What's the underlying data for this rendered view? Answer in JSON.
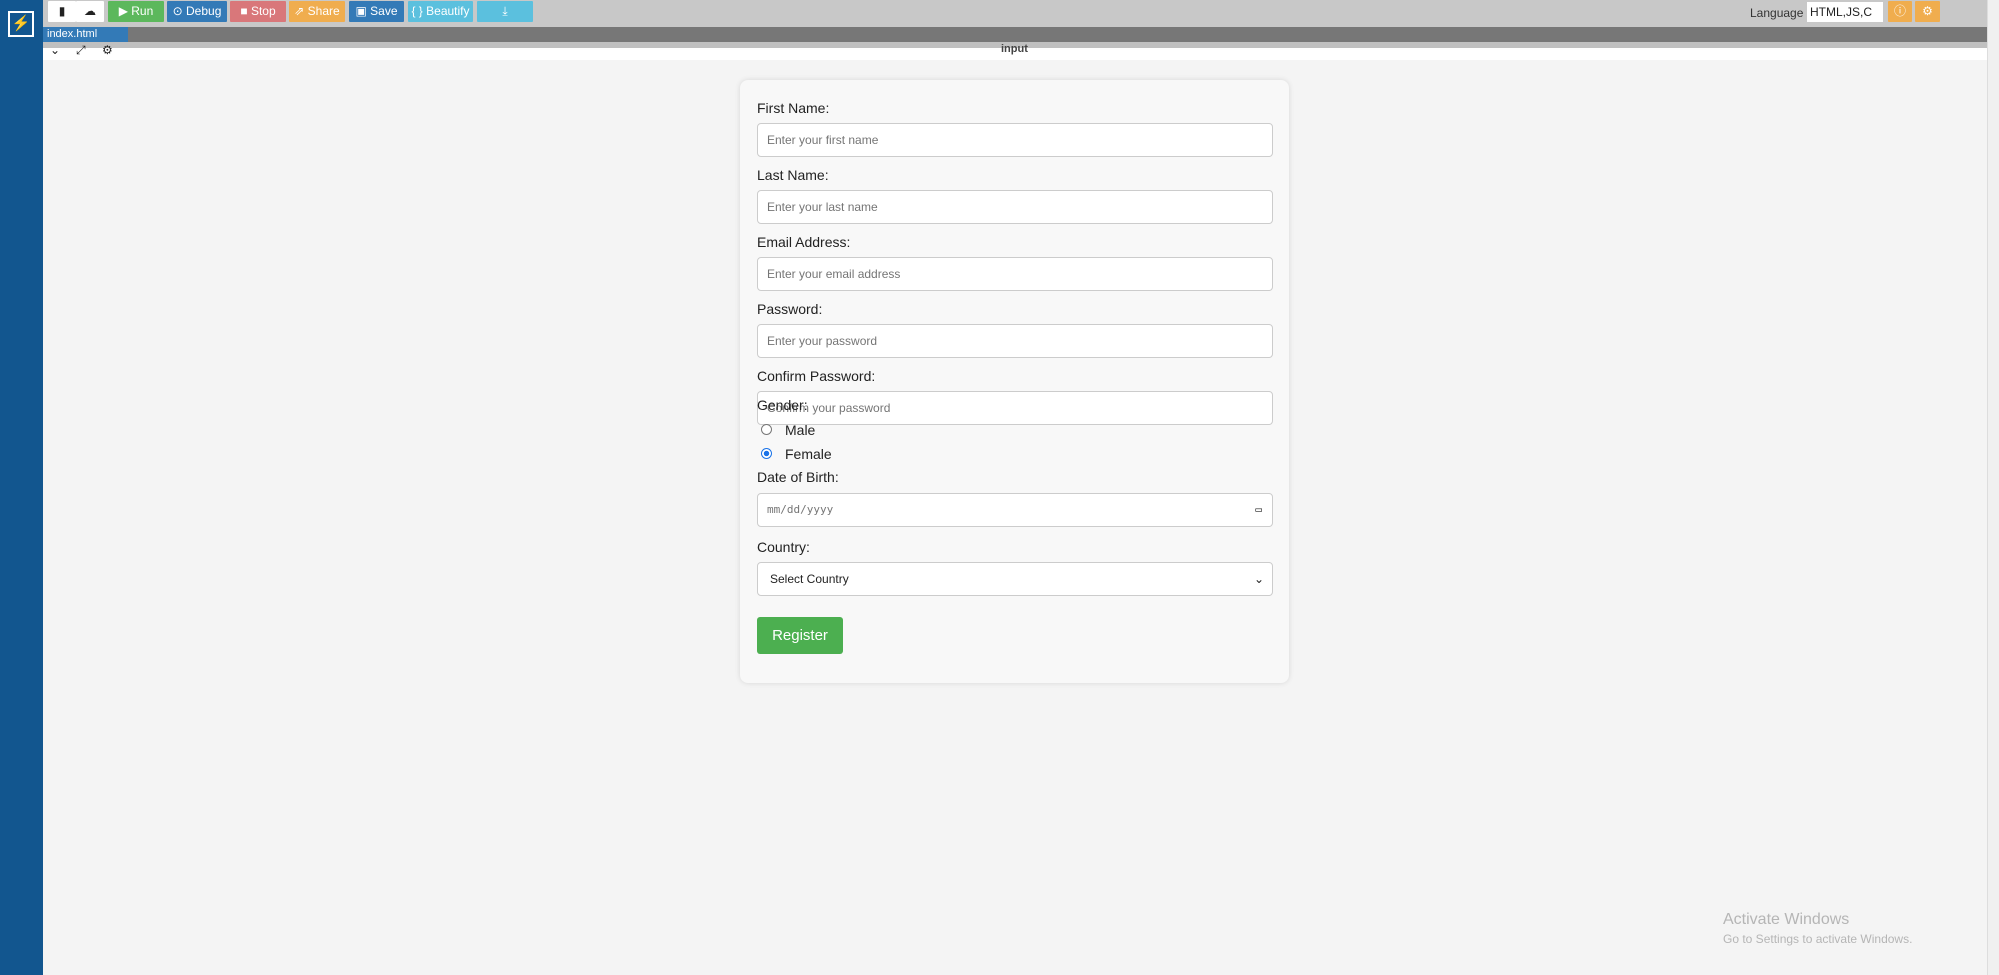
{
  "toolbar": {
    "run": "Run",
    "debug": "Debug",
    "stop": "Stop",
    "share": "Share",
    "save": "Save",
    "beautify": "{ } Beautify",
    "language_label": "Language",
    "language_value": "HTML,JS,C"
  },
  "colors": {
    "run": "#5cb85c",
    "debug": "#337ab7",
    "stop": "#d9777a",
    "share": "#f0ad4e",
    "save": "#337ab7",
    "beautify": "#5bc0de",
    "sidebar": "#12568f",
    "register": "#4caf50"
  },
  "tab": {
    "label": "index.html"
  },
  "panel": {
    "title": "input"
  },
  "form": {
    "first_name": {
      "label": "First Name:",
      "placeholder": "Enter your first name"
    },
    "last_name": {
      "label": "Last Name:",
      "placeholder": "Enter your last name"
    },
    "email": {
      "label": "Email Address:",
      "placeholder": "Enter your email address"
    },
    "password": {
      "label": "Password:",
      "placeholder": "Enter your password"
    },
    "confirm": {
      "label": "Confirm Password:",
      "placeholder": "Confirm your password"
    },
    "gender": {
      "label": "Gender:",
      "options": [
        "Male",
        "Female"
      ],
      "selected": "Female"
    },
    "dob": {
      "label": "Date of Birth:",
      "placeholder": "mm/dd/yyyy"
    },
    "country": {
      "label": "Country:",
      "selected": "Select Country"
    },
    "register": "Register"
  },
  "watermark": {
    "title": "Activate Windows",
    "subtitle": "Go to Settings to activate Windows."
  }
}
